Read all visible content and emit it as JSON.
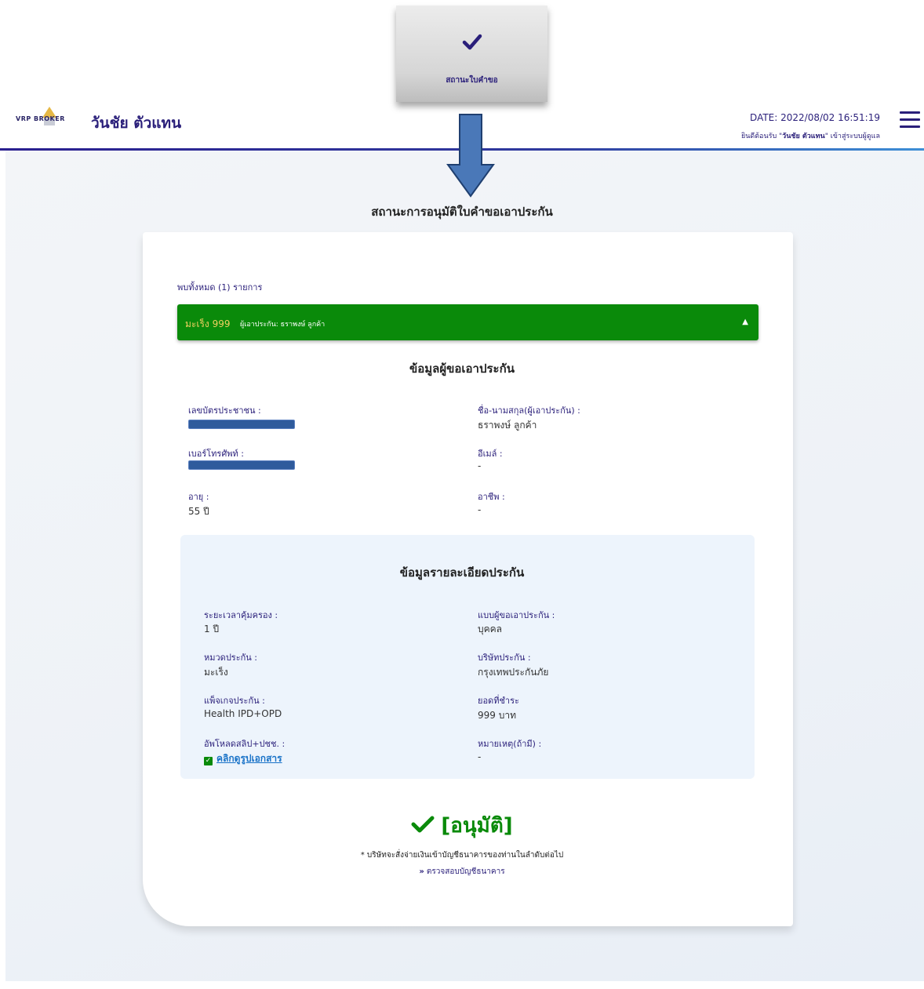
{
  "header": {
    "logo_text": "VRP BROKER",
    "user_name": "วันชัย ตัวแทน",
    "date_text": "DATE: 2022/08/02 16:51:19",
    "welcome_prefix": "ยินดีต้อนรับ \"",
    "welcome_name": "วันชัย ตัวแทน",
    "welcome_suffix": "\" เข้าสู่ระบบผู้ดูแล",
    "menu_icon": "hamburger-icon"
  },
  "overlay": {
    "label": "สถานะใบคำขอ",
    "icon": "check-icon"
  },
  "page_title": "สถานะการอนุมัติใบคำขอเอาประกัน",
  "result": {
    "found_text": "พบทั้งหมด (1) รายการ",
    "item_category": "มะเร็ง 999",
    "item_insured": "ผู้เอาประกัน: ธราพงษ์ ลูกค้า"
  },
  "applicant": {
    "section_title": "ข้อมูลผู้ขอเอาประกัน",
    "id_label": "เลขบัตรประชาชน :",
    "name_label": "ชื่อ-นามสกุล(ผู้เอาประกัน) :",
    "name_value": "ธราพงษ์ ลูกค้า",
    "phone_label": "เบอร์โทรศัพท์ :",
    "email_label": "อีเมล์ :",
    "email_value": "-",
    "age_label": "อายุ :",
    "age_value": "55 ปี",
    "occupation_label": "อาชีพ :",
    "occupation_value": "-"
  },
  "insurance": {
    "section_title": "ข้อมูลรายละเอียดประกัน",
    "period_label": "ระยะเวลาคุ้มครอง :",
    "period_value": "1 ปี",
    "type_label": "แบบผู้ขอเอาประกัน :",
    "type_value": "บุคคล",
    "category_label": "หมวดประกัน :",
    "category_value": "มะเร็ง",
    "company_label": "บริษัทประกัน :",
    "company_value": "กรุงเทพประกันภัย",
    "package_label": "แพ็จเกจประกัน :",
    "package_value": "Health IPD+OPD",
    "amount_label": "ยอดที่ชำระ",
    "amount_value": "999 บาท",
    "upload_label": "อัพโหลดสลิป+ปชช. :",
    "upload_link": "คลิกดูรูปเอกสาร",
    "note_label": "หมายเหตุ(ถ้ามี) :",
    "note_value": "-"
  },
  "status": {
    "approved_text": "[อนุมัติ]",
    "pay_note": "* บริษัทจะสั่งจ่ายเงินเข้าบัญชีธนาคารของท่านในลำดับต่อไป",
    "bank_link": "ตรวจสอบบัญชีธนาคาร"
  },
  "colors": {
    "brand": "#2a1f7a",
    "approved": "#0a8a0a",
    "link": "#1a73c8"
  }
}
